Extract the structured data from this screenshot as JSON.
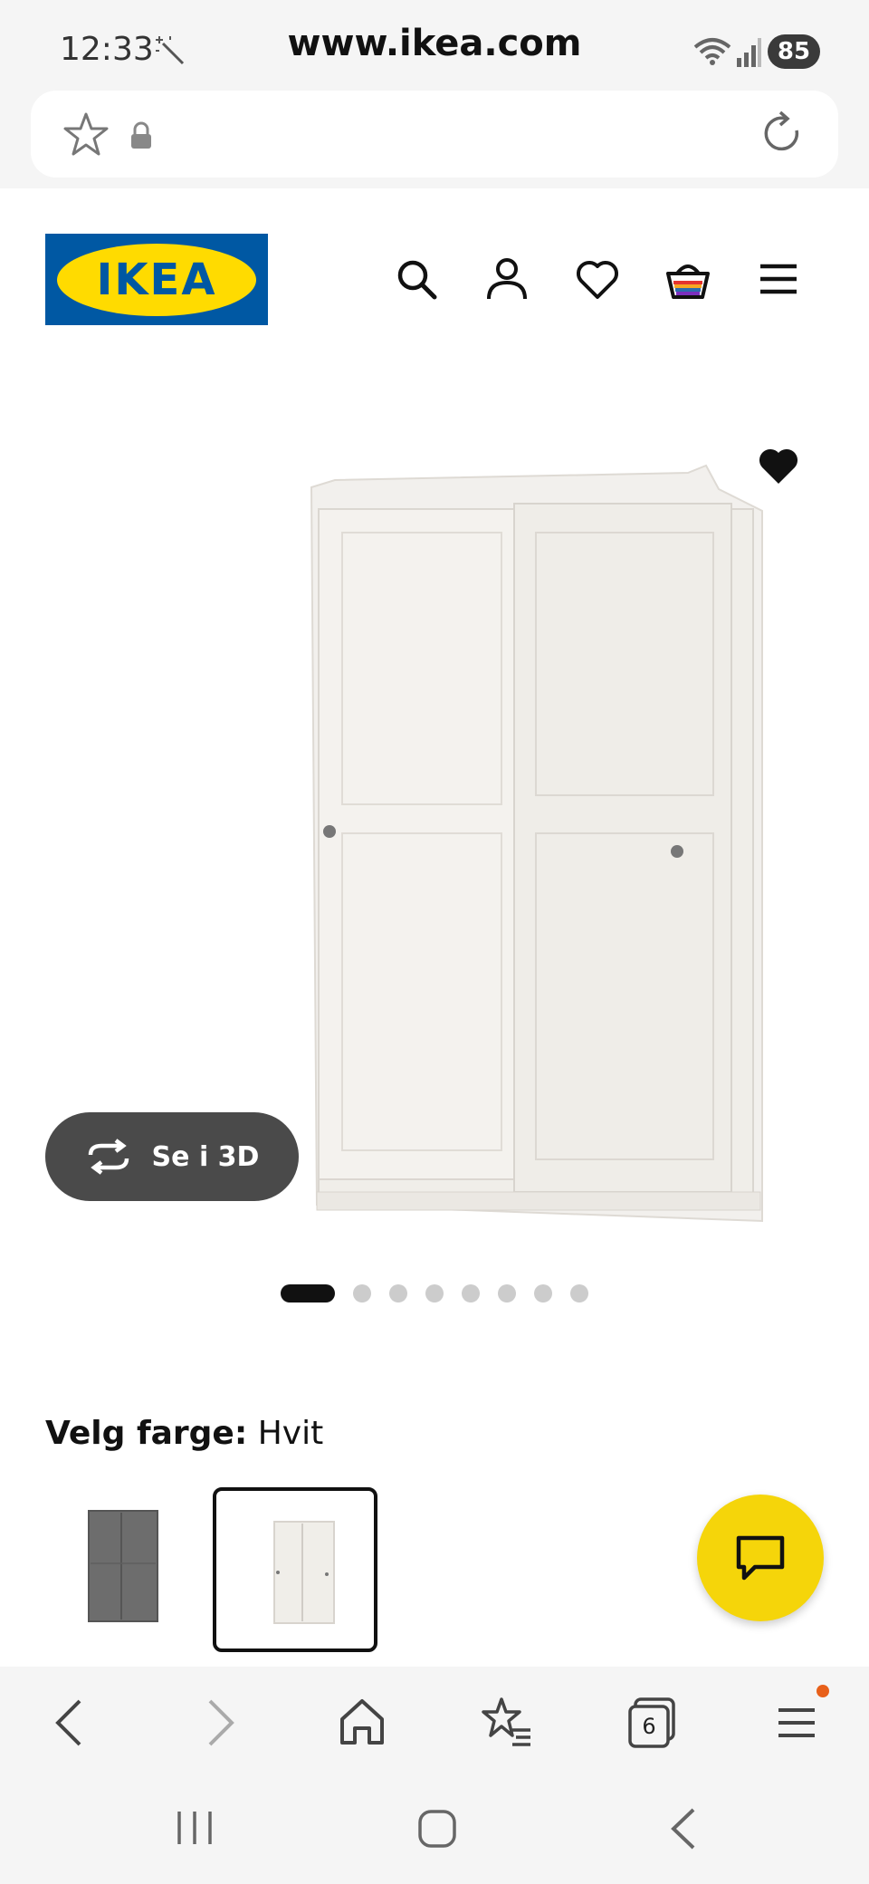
{
  "status_bar": {
    "time": "12:33",
    "battery": "85"
  },
  "browser": {
    "url": "www.ikea.com",
    "tabs_count": "6"
  },
  "site": {
    "logo_text": "IKEA",
    "brand_colors": {
      "blue": "#0058a3",
      "yellow": "#ffdb00"
    }
  },
  "header_icons": [
    "search-icon",
    "user-icon",
    "heart-icon",
    "basket-icon",
    "menu-icon"
  ],
  "product": {
    "view_3d_label": "Se i 3D",
    "carousel": {
      "total_images": 8,
      "active_index": 0
    }
  },
  "color_picker": {
    "label": "Velg farge:",
    "selected": "Hvit",
    "options": [
      "grey-wardrobe",
      "white-wardrobe"
    ],
    "selected_index": 1
  },
  "chat_button_color": "#f5d50a"
}
